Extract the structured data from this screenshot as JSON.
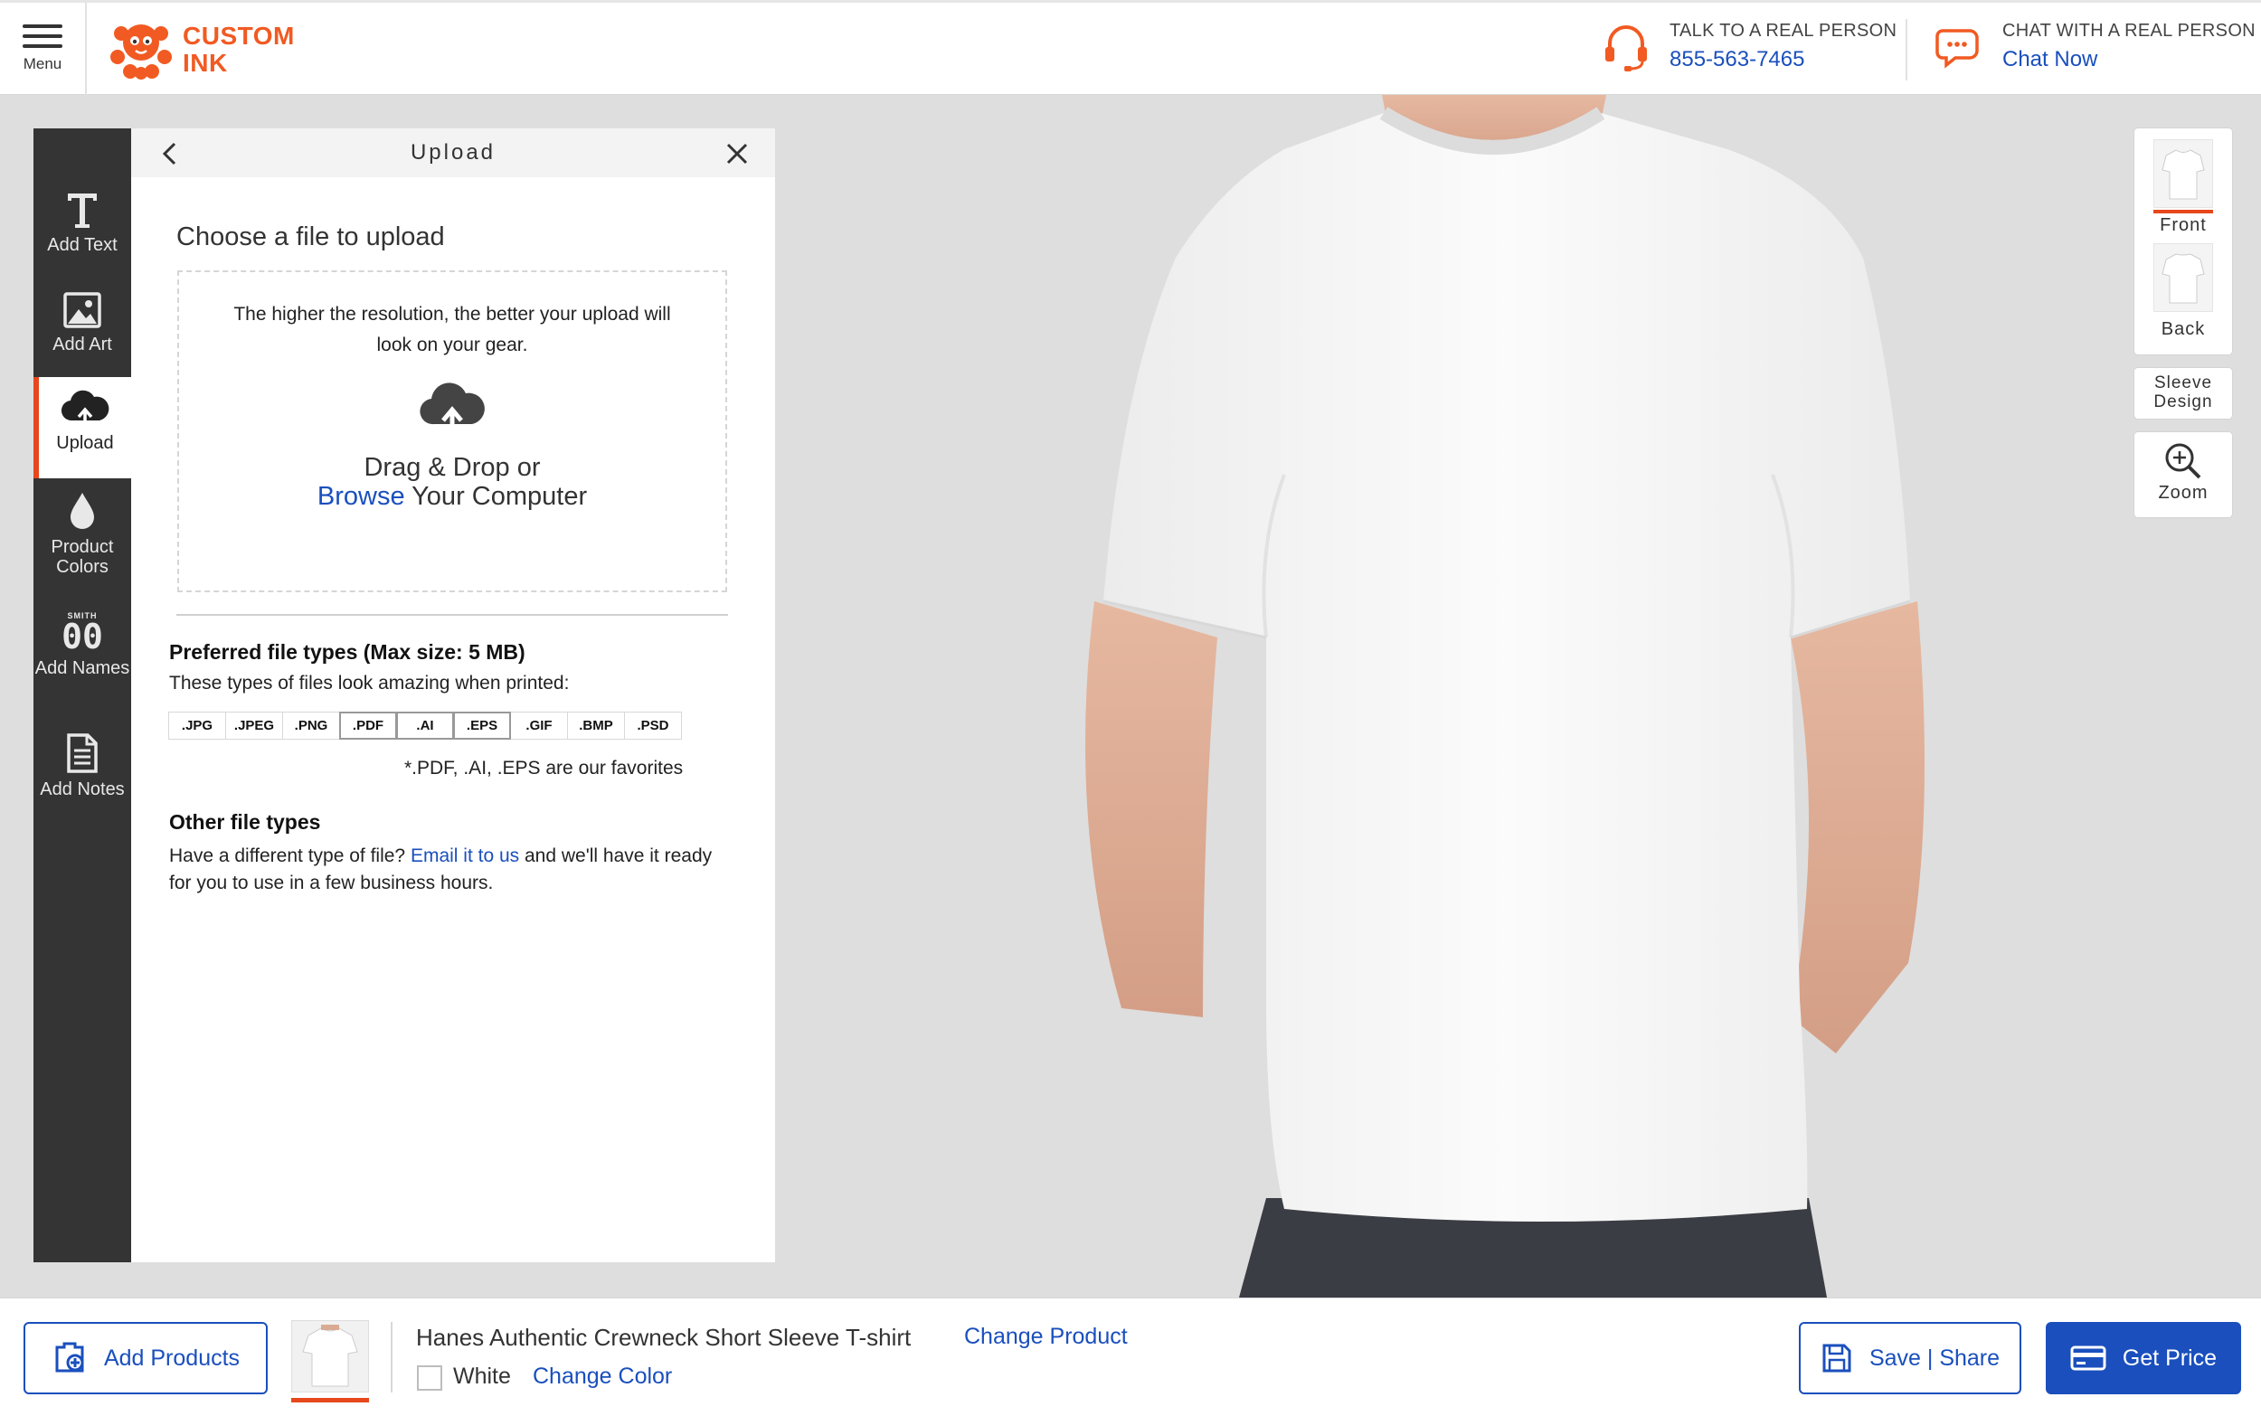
{
  "header": {
    "menu_label": "Menu",
    "logo_line1": "CUSTOM",
    "logo_line2": "INK",
    "phone_caption": "TALK TO A REAL PERSON",
    "phone_number": "855-563-7465",
    "chat_caption": "CHAT WITH A REAL PERSON",
    "chat_link": "Chat Now"
  },
  "toolbar": {
    "items": [
      {
        "label": "Add Text",
        "icon": "text-icon"
      },
      {
        "label": "Add Art",
        "icon": "image-icon"
      },
      {
        "label": "Upload",
        "icon": "cloud-upload-icon",
        "active": true
      },
      {
        "label": "Product Colors",
        "icon": "droplet-icon"
      },
      {
        "label": "Add Names",
        "icon": "jersey-number-icon"
      },
      {
        "label": "Add Notes",
        "icon": "notes-icon"
      }
    ],
    "names_icon_caption": "SMITH",
    "names_icon_digits": "00"
  },
  "upload_panel": {
    "title": "Upload",
    "heading": "Choose a file to upload",
    "resolution_note": "The higher the resolution, the better your upload will look on your gear.",
    "drag_text": "Drag & Drop or",
    "browse_link": "Browse",
    "browse_suffix": " Your Computer",
    "preferred_title": "Preferred file types (Max size: 5 MB)",
    "preferred_sub": "These types of files look amazing when printed:",
    "file_types": [
      ".JPG",
      ".JPEG",
      ".PNG",
      ".PDF",
      ".AI",
      ".EPS",
      ".GIF",
      ".BMP",
      ".PSD"
    ],
    "favorite_types": [
      ".PDF",
      ".AI",
      ".EPS"
    ],
    "favorites_note": "*.PDF, .AI, .EPS are our favorites",
    "other_title": "Other file types",
    "other_text_before": "Have a different type of file? ",
    "other_link": "Email it to us",
    "other_text_after": " and we'll have it ready for you to use in a few business hours."
  },
  "views": {
    "front": "Front",
    "back": "Back",
    "sleeve": "Sleeve Design",
    "zoom": "Zoom"
  },
  "bottom": {
    "add_products": "Add Products",
    "product_name": "Hanes Authentic Crewneck Short Sleeve T-shirt",
    "change_product": "Change Product",
    "color_name": "White",
    "change_color": "Change Color",
    "save_share": "Save | Share",
    "get_price": "Get Price"
  },
  "colors": {
    "accent": "#1a4fbd",
    "brand": "#f15a22",
    "toolbar_bg": "#343434",
    "active_marker": "#e7471c",
    "stage_bg": "#dedede"
  }
}
